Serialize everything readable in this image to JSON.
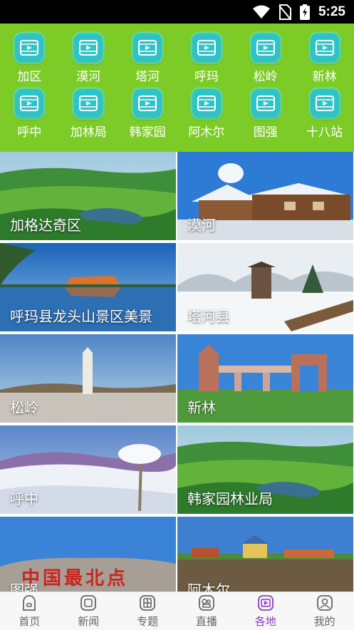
{
  "status_bar": {
    "time": "5:25"
  },
  "regions": [
    {
      "label": "加区"
    },
    {
      "label": "漠河"
    },
    {
      "label": "塔河"
    },
    {
      "label": "呼玛"
    },
    {
      "label": "松岭"
    },
    {
      "label": "新林"
    },
    {
      "label": "呼中"
    },
    {
      "label": "加林局"
    },
    {
      "label": "韩家园"
    },
    {
      "label": "阿木尔"
    },
    {
      "label": "图强"
    },
    {
      "label": "十八站"
    }
  ],
  "tiles": [
    {
      "caption": "加格达奇区",
      "scene": "grassland"
    },
    {
      "caption": "漠河",
      "scene": "snow-lodge"
    },
    {
      "caption": "呼玛县龙头山景区美景",
      "scene": "lake-rock"
    },
    {
      "caption": "塔河县",
      "scene": "snow-pavilion"
    },
    {
      "caption": "松岭",
      "scene": "monument"
    },
    {
      "caption": "新林",
      "scene": "gate"
    },
    {
      "caption": "呼中",
      "scene": "frost-mountain"
    },
    {
      "caption": "韩家园林业局",
      "scene": "grassland"
    },
    {
      "caption": "图强",
      "scene": "rock-inscription"
    },
    {
      "caption": "阿木尔",
      "scene": "village"
    }
  ],
  "inscription_text": "中国最北点",
  "tabbar": [
    {
      "label": "首页",
      "icon": "home-icon"
    },
    {
      "label": "新闻",
      "icon": "news-icon"
    },
    {
      "label": "专题",
      "icon": "topic-icon"
    },
    {
      "label": "直播",
      "icon": "live-icon"
    },
    {
      "label": "各地",
      "icon": "local-icon",
      "active": true
    },
    {
      "label": "我的",
      "icon": "profile-icon"
    }
  ],
  "colors": {
    "header_green": "#7ccb26",
    "badge_teal": "#2fc3c7",
    "active_tab": "#8d3fb8"
  }
}
